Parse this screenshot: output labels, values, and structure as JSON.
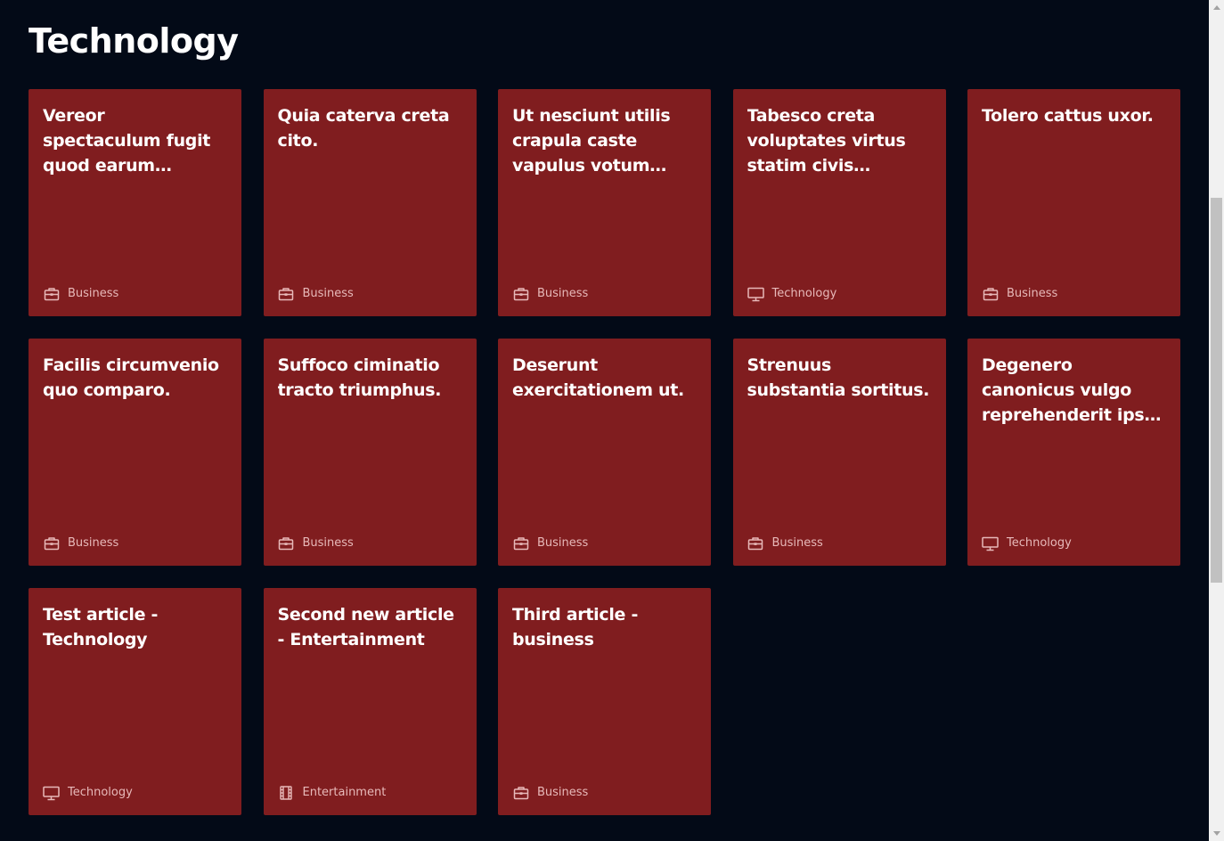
{
  "page": {
    "title": "Technology"
  },
  "articles": [
    {
      "title": "Vereor spectaculum fugit quod earum deleniti adulescens...",
      "category": "Business",
      "icon": "briefcase-icon"
    },
    {
      "title": "Quia caterva creta cito.",
      "category": "Business",
      "icon": "briefcase-icon"
    },
    {
      "title": "Ut nesciunt utilis crapula caste vapulus votum aperio.",
      "category": "Business",
      "icon": "briefcase-icon"
    },
    {
      "title": "Tabesco creta voluptates virtus statim civis suffoco...",
      "category": "Technology",
      "icon": "monitor-icon"
    },
    {
      "title": "Tolero cattus uxor.",
      "category": "Business",
      "icon": "briefcase-icon"
    },
    {
      "title": "Facilis circumvenio quo comparo.",
      "category": "Business",
      "icon": "briefcase-icon"
    },
    {
      "title": "Suffoco ciminatio tracto triumphus.",
      "category": "Business",
      "icon": "briefcase-icon"
    },
    {
      "title": "Deserunt exercitationem ut.",
      "category": "Business",
      "icon": "briefcase-icon"
    },
    {
      "title": "Strenuus substantia sortitus.",
      "category": "Business",
      "icon": "briefcase-icon"
    },
    {
      "title": "Degenero canonicus vulgo reprehenderit ipsa curatio commo...",
      "category": "Technology",
      "icon": "monitor-icon"
    },
    {
      "title": "Test article - Technology",
      "category": "Technology",
      "icon": "monitor-icon"
    },
    {
      "title": "Second new article - Entertainment",
      "category": "Entertainment",
      "icon": "film-icon"
    },
    {
      "title": "Third article - business",
      "category": "Business",
      "icon": "briefcase-icon"
    }
  ],
  "colors": {
    "background": "#030a17",
    "card": "#801d1f",
    "card_text": "#ffffff",
    "category_text": "#e7b9b9",
    "scrollbar_track": "#f1f1f1",
    "scrollbar_thumb": "#c1c1c1"
  }
}
